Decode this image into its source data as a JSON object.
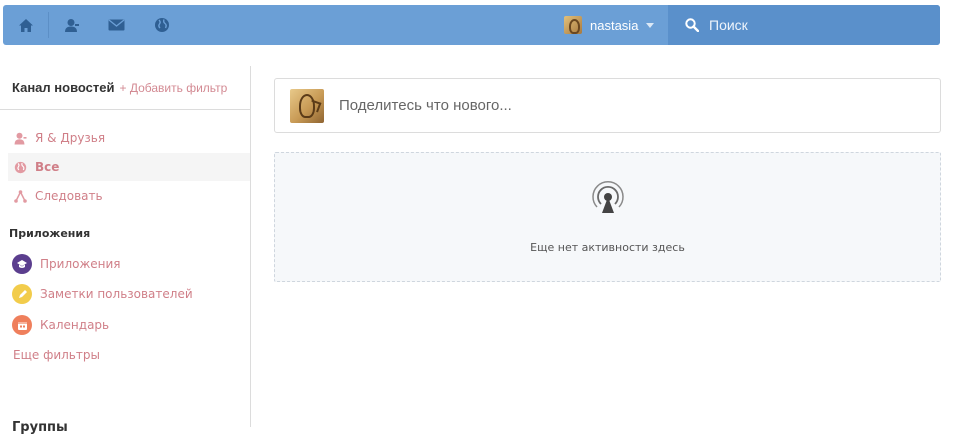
{
  "topbar": {
    "nav": [
      {
        "name": "home-icon"
      },
      {
        "name": "user-icon"
      },
      {
        "name": "mail-icon"
      },
      {
        "name": "globe-icon"
      }
    ],
    "username": "nastasia",
    "search_placeholder": "Поиск",
    "colors": {
      "bar": "#6b9fd6",
      "search": "#5a90cb"
    }
  },
  "sidebar": {
    "title": "Канал новостей",
    "add_filter": "+ Добавить фильтр",
    "items": [
      {
        "label": "Я & Друзья",
        "icon": "user-icon"
      },
      {
        "label": "Все",
        "icon": "globe-icon",
        "active": true
      },
      {
        "label": "Следовать",
        "icon": "share-icon"
      }
    ],
    "apps_section": "Приложения",
    "apps": [
      {
        "label": "Приложения",
        "icon": "apps-icon",
        "color": "#5b3e8e"
      },
      {
        "label": "Заметки пользователей",
        "icon": "pencil-icon",
        "color": "#f2cc4b"
      },
      {
        "label": "Календарь",
        "icon": "calendar-icon",
        "color": "#ef7f5c"
      }
    ],
    "more_filters": "Еще фильтры",
    "groups": "Группы",
    "link_color": "#d07f88"
  },
  "main": {
    "share_placeholder": "Поделитесь что нового...",
    "empty_text": "Еще нет активности здесь"
  }
}
